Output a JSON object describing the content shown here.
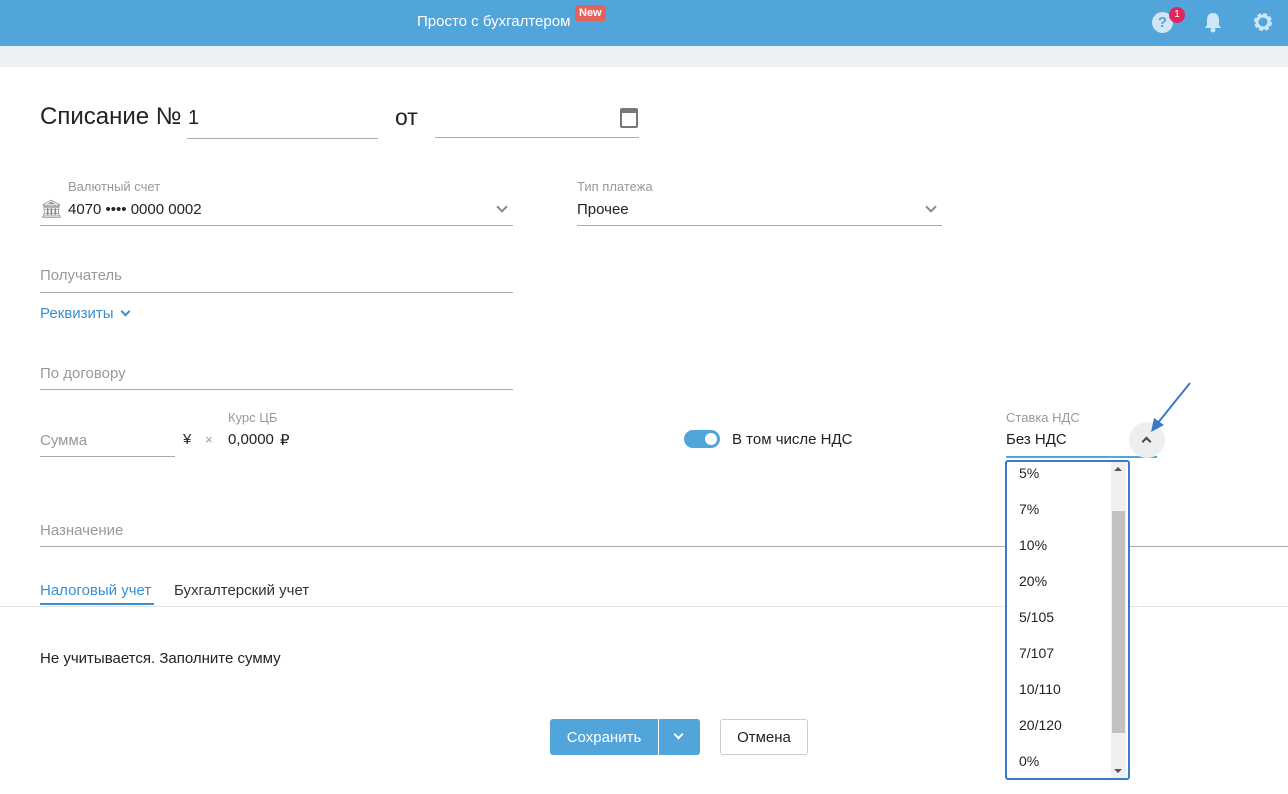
{
  "header": {
    "title": "Просто с бухгалтером",
    "badge": "New",
    "help_count": "1"
  },
  "form": {
    "title": "Списание №",
    "number": "1",
    "from": "от",
    "date": "",
    "account_label": "Валютный счет",
    "account_value": "4070 •••• 0000 0002",
    "payment_type_label": "Тип платежа",
    "payment_type_value": "Прочее",
    "recipient_placeholder": "Получатель",
    "requisites_link": "Реквизиты",
    "contract_placeholder": "По договору",
    "sum_placeholder": "Сумма",
    "currency_symbol": "¥",
    "times": "×",
    "rate_label": "Курс ЦБ",
    "rate_value": "0,0000",
    "rub_symbol": "₽",
    "vat_toggle_label": "В том числе НДС",
    "vat_toggle_on": true,
    "vat_rate_label": "Ставка НДС",
    "vat_rate_value": "Без НДС",
    "purpose_placeholder": "Назначение"
  },
  "vat_options": [
    "5%",
    "7%",
    "10%",
    "20%",
    "5/105",
    "7/107",
    "10/110",
    "20/120",
    "0%"
  ],
  "tabs": [
    {
      "label": "Налоговый учет",
      "active": true
    },
    {
      "label": "Бухгалтерский учет",
      "active": false
    }
  ],
  "tax_note": "Не учитывается. Заполните сумму",
  "buttons": {
    "save": "Сохранить",
    "cancel": "Отмена"
  },
  "colors": {
    "brand": "#52a5db",
    "accent": "#3a7bc8",
    "badge": "#e8605c"
  }
}
